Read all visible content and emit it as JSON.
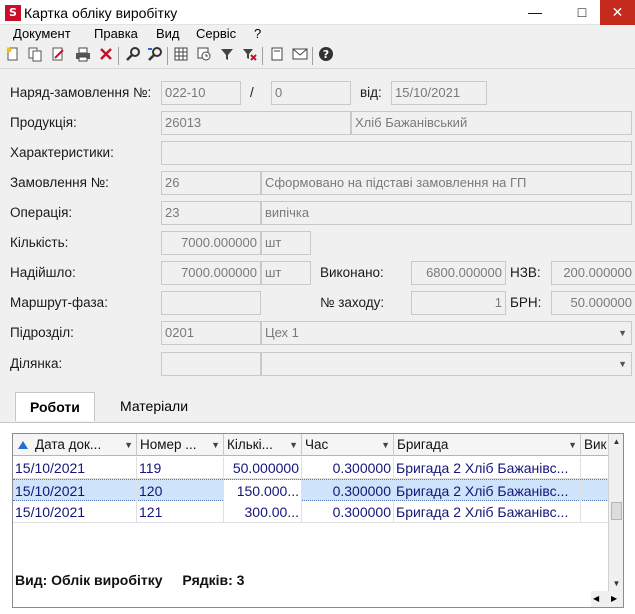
{
  "window": {
    "logo": "S",
    "title": "Картка обліку виробітку",
    "minimize": "—",
    "maximize": "□",
    "close": "✕"
  },
  "menu": [
    "Документ",
    "Правка",
    "Вид",
    "Сервіс",
    "?"
  ],
  "toolbar_icons": [
    "new-document-icon",
    "copy-document-icon",
    "edit-document-icon",
    "print-icon",
    "delete-icon",
    "find-icon",
    "find-next-icon",
    "table-icon",
    "refresh-icon",
    "filter-icon",
    "clear-filter-icon",
    "properties-icon",
    "email-icon",
    "help-icon"
  ],
  "form": {
    "order_label": "Наряд-замовлення №:",
    "order_number": "022-10",
    "order_sep": "/",
    "order_subnumber": "0",
    "date_label": "від:",
    "date": "15/10/2021",
    "product_label": "Продукція:",
    "product_code": "26013",
    "product_name": "Хліб Бажанівський",
    "characteristics_label": "Характеристики:",
    "characteristics": "",
    "order_no_label": "Замовлення №:",
    "order_no": "26",
    "order_note": "Сформовано на підставі замовлення на ГП",
    "operation_label": "Операція:",
    "operation_code": "23",
    "operation_name": "випічка",
    "quantity_label": "Кількість:",
    "quantity": "7000.000000",
    "quantity_unit": "шт",
    "received_label": "Надійшло:",
    "received": "7000.000000",
    "received_unit": "шт",
    "done_label": "Виконано:",
    "done": "6800.000000",
    "nzv_label": "НЗВ:",
    "nzv": "200.000000",
    "route_label": "Маршрут-фаза:",
    "route": "",
    "attempt_label": "№ заходу:",
    "attempt": "1",
    "brn_label": "БРН:",
    "brn": "50.000000",
    "division_label": "Підрозділ:",
    "division_code": "0201",
    "division_name": "Цех 1",
    "section_label": "Ділянка:",
    "section_code": "",
    "section_name": ""
  },
  "tabs": [
    "Роботи",
    "Матеріали"
  ],
  "grid": {
    "columns": [
      "Дата док...",
      "Номер ...",
      "Кількі...",
      "Час",
      "Бригада",
      "Вик"
    ],
    "rows": [
      {
        "date": "15/10/2021",
        "number": "119",
        "qty": "50.000000",
        "time": "0.300000",
        "brigade": "Бригада 2 Хліб Бажанівс...",
        "vyk": ""
      },
      {
        "date": "15/10/2021",
        "number": "120",
        "qty": "150.000...",
        "time": "0.300000",
        "brigade": "Бригада 2 Хліб Бажанівс...",
        "vyk": ""
      },
      {
        "date": "15/10/2021",
        "number": "121",
        "qty": "300.00...",
        "time": "0.300000",
        "brigade": "Бригада 2 Хліб Бажанівс...",
        "vyk": ""
      }
    ],
    "status_view": "Вид: Облік виробітку",
    "status_rows": "Рядків: 3"
  }
}
